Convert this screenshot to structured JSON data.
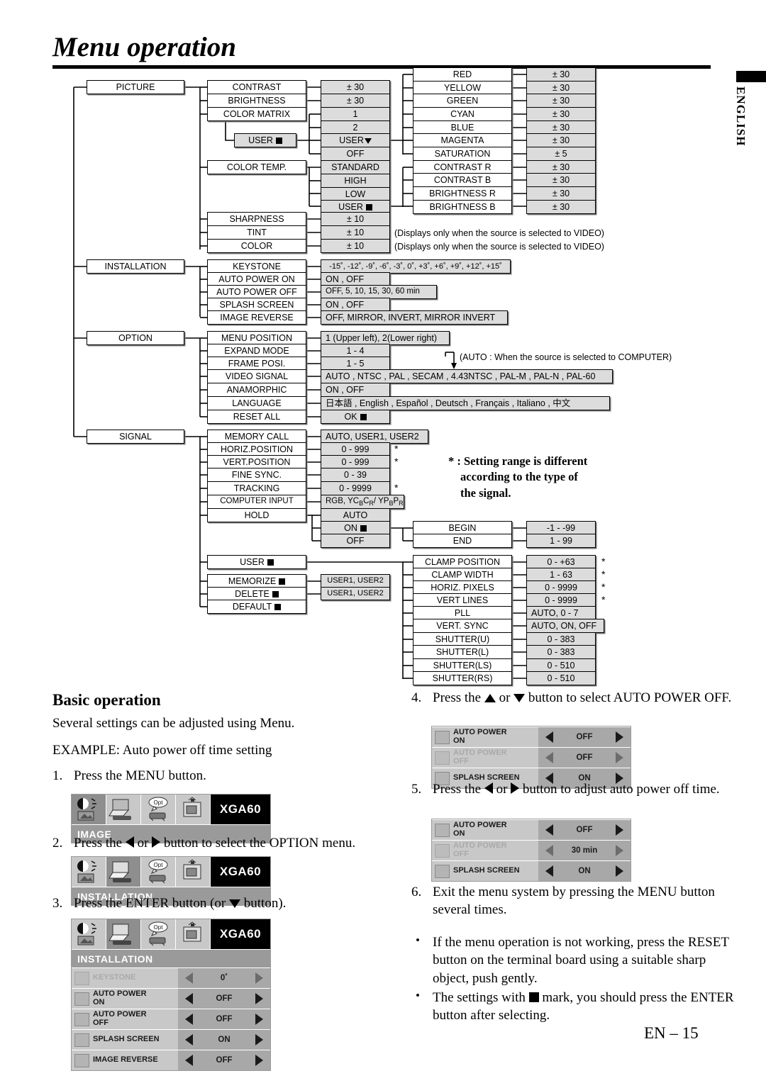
{
  "header": {
    "title": "Menu operation",
    "side_tab": "ENGLISH"
  },
  "page_number": "EN – 15",
  "diagram": {
    "menus": [
      {
        "label": "PICTURE"
      },
      {
        "label": "INSTALLATION"
      },
      {
        "label": "OPTION"
      },
      {
        "label": "SIGNAL"
      }
    ],
    "picture": {
      "items": [
        {
          "label": "CONTRAST",
          "value": "± 30"
        },
        {
          "label": "BRIGHTNESS",
          "value": "± 30"
        },
        {
          "label": "COLOR MATRIX",
          "values": [
            "1",
            "2",
            "USER",
            "OFF"
          ]
        },
        {
          "label": "USER"
        },
        {
          "label": "COLOR TEMP.",
          "values": [
            "STANDARD",
            "HIGH",
            "LOW",
            "USER"
          ]
        },
        {
          "label": "SHARPNESS",
          "value": "± 10"
        },
        {
          "label": "TINT",
          "value": "± 10"
        },
        {
          "label": "COLOR",
          "value": "± 10"
        }
      ],
      "color_matrix_user": [
        {
          "label": "RED",
          "value": "± 30"
        },
        {
          "label": "YELLOW",
          "value": "± 30"
        },
        {
          "label": "GREEN",
          "value": "± 30"
        },
        {
          "label": "CYAN",
          "value": "± 30"
        },
        {
          "label": "BLUE",
          "value": "± 30"
        },
        {
          "label": "MAGENTA",
          "value": "± 30"
        },
        {
          "label": "SATURATION",
          "value": "± 5"
        }
      ],
      "color_temp_user": [
        {
          "label": "CONTRAST R",
          "value": "± 30"
        },
        {
          "label": "CONTRAST B",
          "value": "± 30"
        },
        {
          "label": "BRIGHTNESS R",
          "value": "± 30"
        },
        {
          "label": "BRIGHTNESS B",
          "value": "± 30"
        }
      ],
      "notes": [
        "(Displays only when the source is selected to VIDEO)",
        "(Displays only when the source is selected to VIDEO)"
      ]
    },
    "installation": {
      "items": [
        {
          "label": "KEYSTONE",
          "value": "-15˚, -12˚, -9˚, -6˚, -3˚, 0˚, +3˚, +6˚, +9˚, +12˚, +15˚"
        },
        {
          "label": "AUTO POWER ON",
          "value": "ON , OFF"
        },
        {
          "label": "AUTO POWER OFF",
          "value": "OFF,  5,  10,  15,  30,  60 min"
        },
        {
          "label": "SPLASH SCREEN",
          "value": "ON , OFF"
        },
        {
          "label": "IMAGE REVERSE",
          "value": "OFF, MIRROR, INVERT, MIRROR INVERT"
        }
      ]
    },
    "option": {
      "items": [
        {
          "label": "MENU POSITION",
          "value": "1 (Upper left), 2(Lower right)"
        },
        {
          "label": "EXPAND MODE",
          "value": "1 - 4"
        },
        {
          "label": "FRAME POSI.",
          "value": "1 - 5"
        },
        {
          "label": "VIDEO SIGNAL",
          "value": "AUTO , NTSC , PAL , SECAM , 4.43NTSC , PAL-M , PAL-N , PAL-60"
        },
        {
          "label": "ANAMORPHIC",
          "value": "ON , OFF"
        },
        {
          "label": "LANGUAGE",
          "value": "日本語 , English , Español , Deutsch , Français , Italiano , 中文"
        },
        {
          "label": "RESET ALL",
          "value": "OK"
        }
      ],
      "auto_note": "(AUTO : When the source is selected to COMPUTER)"
    },
    "signal": {
      "items": [
        {
          "label": "MEMORY CALL",
          "value": "AUTO, USER1, USER2",
          "star": false
        },
        {
          "label": "HORIZ.POSITION",
          "value": "0 - 999",
          "star": true
        },
        {
          "label": "VERT.POSITION",
          "value": "0 - 999",
          "star": true
        },
        {
          "label": "FINE SYNC.",
          "value": "0 - 39",
          "star": false
        },
        {
          "label": "TRACKING",
          "value": "0 - 9999",
          "star": true
        },
        {
          "label": "COMPUTER INPUT",
          "value": "RGB, YCBCR / YPBPR",
          "star": false
        },
        {
          "label": "HOLD",
          "values": [
            "AUTO",
            "ON",
            "OFF"
          ]
        }
      ],
      "hold_sub": [
        {
          "label": "BEGIN",
          "value": "-1 - -99"
        },
        {
          "label": "END",
          "value": "1 - 99"
        }
      ],
      "user_items": [
        {
          "label": "USER"
        },
        {
          "label": "MEMORIZE",
          "value": "USER1, USER2"
        },
        {
          "label": "DELETE",
          "value": "USER1, USER2"
        },
        {
          "label": "DEFAULT"
        }
      ],
      "user_detail": [
        {
          "label": "CLAMP POSITION",
          "value": "0 - +63",
          "star": true
        },
        {
          "label": "CLAMP WIDTH",
          "value": "1 - 63",
          "star": true
        },
        {
          "label": "HORIZ. PIXELS",
          "value": "0 - 9999",
          "star": true
        },
        {
          "label": "VERT LINES",
          "value": "0 - 9999",
          "star": true
        },
        {
          "label": "PLL",
          "value": "AUTO, 0 - 7",
          "star": false
        },
        {
          "label": "VERT. SYNC",
          "value": "AUTO, ON, OFF",
          "star": false
        },
        {
          "label": "SHUTTER(U)",
          "value": "0 - 383",
          "star": false
        },
        {
          "label": "SHUTTER(L)",
          "value": "0 - 383",
          "star": false
        },
        {
          "label": "SHUTTER(LS)",
          "value": "0 - 510",
          "star": false
        },
        {
          "label": "SHUTTER(RS)",
          "value": "0 - 510",
          "star": false
        }
      ],
      "star_note_line1": "* : Setting range is different",
      "star_note_line2": "according to the type of",
      "star_note_line3": "the signal."
    }
  },
  "basic_operation": {
    "heading": "Basic operation",
    "intro": "Several settings can be adjusted using Menu.",
    "example": "EXAMPLE: Auto power off time setting",
    "step1_num": "1.",
    "step1_text": "Press the MENU button.",
    "step2_num": "2.",
    "step2_a": "Press the",
    "step2_b": "or",
    "step2_c": "button to select the OPTION menu.",
    "step3_num": "3.",
    "step3_a": "Press the ENTER button (or",
    "step3_b": "button).",
    "step4_num": "4.",
    "step4_a": "Press the",
    "step4_b": "or",
    "step4_c": "button to select AUTO POWER OFF.",
    "step5_num": "5.",
    "step5_a": "Press the",
    "step5_b": "or",
    "step5_c": "button to adjust auto power off time.",
    "step6_num": "6.",
    "step6_text": "Exit the menu system by pressing the MENU button several times.",
    "bullet1": "If the menu operation is not working, press the RESET button on the terminal board using a suitable sharp object, push gently.",
    "bullet2_a": "The settings with",
    "bullet2_b": "mark, you should press the ENTER button after selecting."
  },
  "osd_panels": {
    "panel1": {
      "title": "XGA60",
      "category": "IMAGE",
      "selected_icon": 0,
      "rows": []
    },
    "panel2": {
      "title": "XGA60",
      "category": "INSTALLATION",
      "selected_icon": 1,
      "rows": []
    },
    "panel3": {
      "title": "XGA60",
      "category": "INSTALLATION",
      "selected_icon": 1,
      "rows": [
        {
          "icon": "keystone-icon",
          "label": "KEYSTONE",
          "label2": "",
          "value": "0˚",
          "dim": true
        },
        {
          "icon": "auto-power-on-icon",
          "label": "AUTO POWER",
          "label2": "ON",
          "value": "OFF",
          "dim": false
        },
        {
          "icon": "auto-power-off-icon",
          "label": "AUTO POWER",
          "label2": "OFF",
          "value": "OFF",
          "dim": false
        },
        {
          "icon": "splash-screen-icon",
          "label": "SPLASH SCREEN",
          "label2": "",
          "value": "ON",
          "dim": false
        },
        {
          "icon": "image-reverse-icon",
          "label": "IMAGE REVERSE",
          "label2": "",
          "value": "OFF",
          "dim": false
        }
      ]
    },
    "panel4": {
      "rows": [
        {
          "icon": "auto-power-on-icon",
          "label": "AUTO POWER",
          "label2": "ON",
          "value": "OFF",
          "dim": false
        },
        {
          "icon": "auto-power-off-icon",
          "label": "AUTO POWER",
          "label2": "OFF",
          "value": "OFF",
          "dim": true
        },
        {
          "icon": "splash-screen-icon",
          "label": "SPLASH SCREEN",
          "label2": "",
          "value": "ON",
          "dim": false
        }
      ]
    },
    "panel5": {
      "rows": [
        {
          "icon": "auto-power-on-icon",
          "label": "AUTO POWER",
          "label2": "ON",
          "value": "OFF",
          "dim": false
        },
        {
          "icon": "auto-power-off-icon",
          "label": "AUTO POWER",
          "label2": "OFF",
          "value": "30 min",
          "dim": true
        },
        {
          "icon": "splash-screen-icon",
          "label": "SPLASH SCREEN",
          "label2": "",
          "value": "ON",
          "dim": false
        }
      ]
    }
  }
}
